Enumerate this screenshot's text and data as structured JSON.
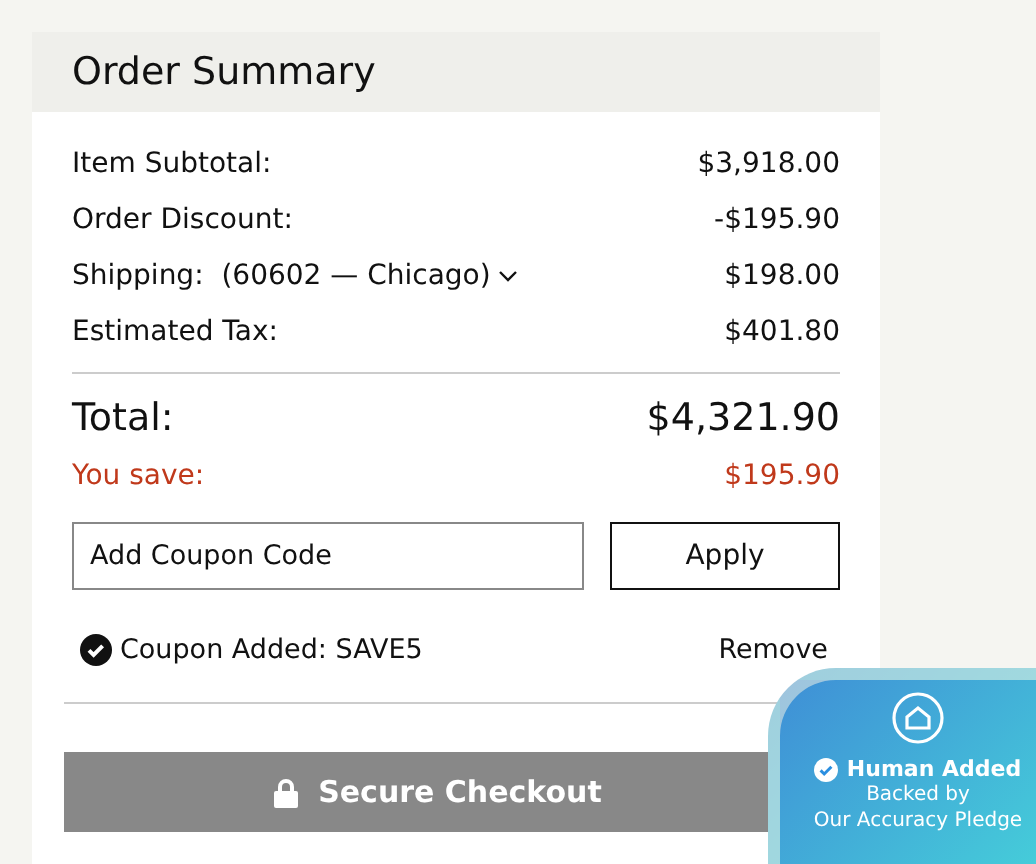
{
  "summary": {
    "title": "Order Summary",
    "lines": [
      {
        "label": "Item Subtotal:",
        "value": "$3,918.00"
      },
      {
        "label": "Order Discount:",
        "value": "-$195.90"
      },
      {
        "label": "Shipping:",
        "detail": "(60602 — Chicago)",
        "value": "$198.00"
      },
      {
        "label": "Estimated Tax:",
        "value": "$401.80"
      }
    ],
    "total": {
      "label": "Total:",
      "value": "$4,321.90"
    },
    "savings": {
      "label": "You save:",
      "value": "$195.90"
    },
    "coupon": {
      "placeholder": "Add Coupon Code",
      "button": "Apply",
      "applied": "Coupon Added: SAVE5",
      "remove": "Remove"
    },
    "checkout": "Secure Checkout"
  },
  "badge": {
    "title": "Human Added",
    "lines": [
      "Backed by",
      "Our Accuracy Pledge"
    ]
  }
}
